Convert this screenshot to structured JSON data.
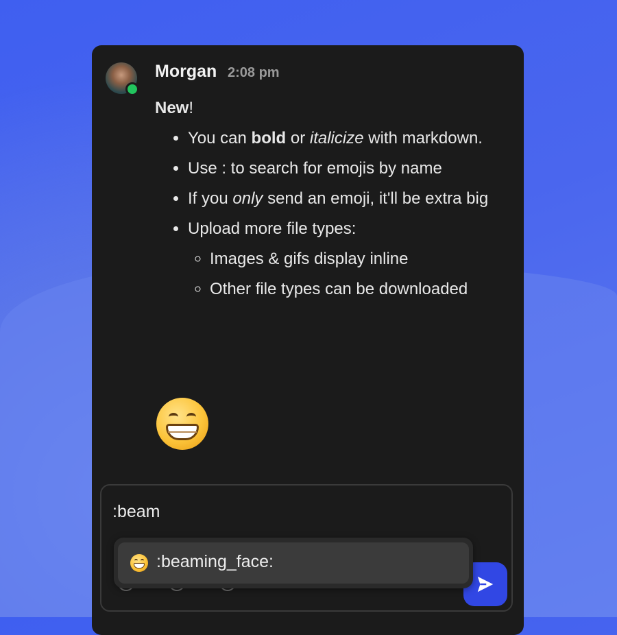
{
  "message": {
    "author": "Morgan",
    "time": "2:08 pm",
    "heading_bold": "New",
    "heading_rest": "!",
    "bullets": {
      "b1_pre": "You can ",
      "b1_bold": "bold",
      "b1_mid": " or ",
      "b1_italic": "italicize",
      "b1_post": " with markdown.",
      "b2": "Use : to search for emojis by name",
      "b3_pre": "If you ",
      "b3_italic": "only",
      "b3_post": " send an emoji, it'll be extra big",
      "b4": "Upload more file types:",
      "sub1": "Images & gifs display inline",
      "sub2": "Other file types can be downloaded"
    },
    "big_emoji": "beaming-face-emoji"
  },
  "composer": {
    "value": ":beam",
    "send_icon": "send-icon",
    "tool_icons": [
      "attachment-icon",
      "emoji-icon",
      "mention-icon"
    ]
  },
  "autocomplete": {
    "emoji": "beaming-face-emoji",
    "label": ":beaming_face:"
  },
  "colors": {
    "background": "#4a66ee",
    "panel": "#1b1b1b",
    "accent": "#3147e4",
    "online": "#22c55e"
  }
}
